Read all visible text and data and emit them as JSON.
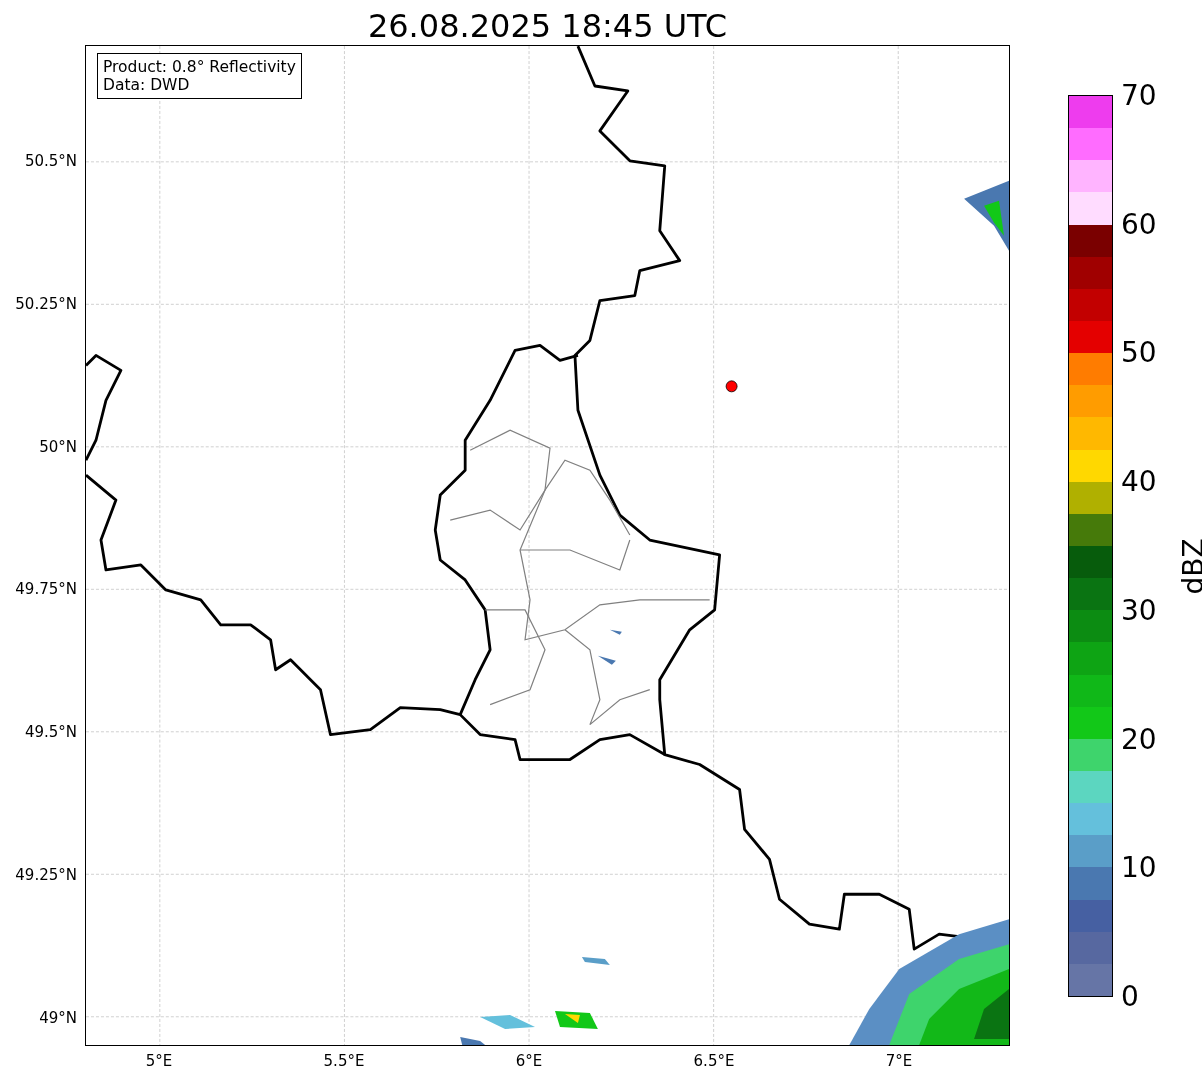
{
  "title": "26.08.2025 18:45 UTC",
  "info_box": {
    "lines": [
      "Product: 0.8° Reflectivity",
      "Data: DWD"
    ]
  },
  "map": {
    "y_ticks": [
      "50.5°N",
      "50.25°N",
      "50°N",
      "49.75°N",
      "49.5°N",
      "49.25°N",
      "49°N"
    ],
    "x_ticks": [
      "5°E",
      "5.5°E",
      "6°E",
      "6.5°E",
      "7°E"
    ]
  },
  "colorbar": {
    "label": "dBZ",
    "ticks": [
      "70",
      "60",
      "50",
      "40",
      "30",
      "20",
      "10",
      "0"
    ],
    "segments": [
      {
        "color": "#6675a6"
      },
      {
        "color": "#5768a0"
      },
      {
        "color": "#4660a2"
      },
      {
        "color": "#4a78b0"
      },
      {
        "color": "#5a9ec8"
      },
      {
        "color": "#64c0dc"
      },
      {
        "color": "#5cd6c0"
      },
      {
        "color": "#3ed46c"
      },
      {
        "color": "#12c818"
      },
      {
        "color": "#10b818"
      },
      {
        "color": "#0ea414"
      },
      {
        "color": "#0c8c12"
      },
      {
        "color": "#0a7412"
      },
      {
        "color": "#075c0c"
      },
      {
        "color": "#467a0a"
      },
      {
        "color": "#b0b000"
      },
      {
        "color": "#ffd800"
      },
      {
        "color": "#ffb800"
      },
      {
        "color": "#ff9c00"
      },
      {
        "color": "#ff7c00"
      },
      {
        "color": "#e40000"
      },
      {
        "color": "#c20000"
      },
      {
        "color": "#a00000"
      },
      {
        "color": "#7a0000"
      },
      {
        "color": "#ffdcff"
      },
      {
        "color": "#ffb4ff"
      },
      {
        "color": "#ff6cff"
      },
      {
        "color": "#ee3cee"
      }
    ]
  }
}
